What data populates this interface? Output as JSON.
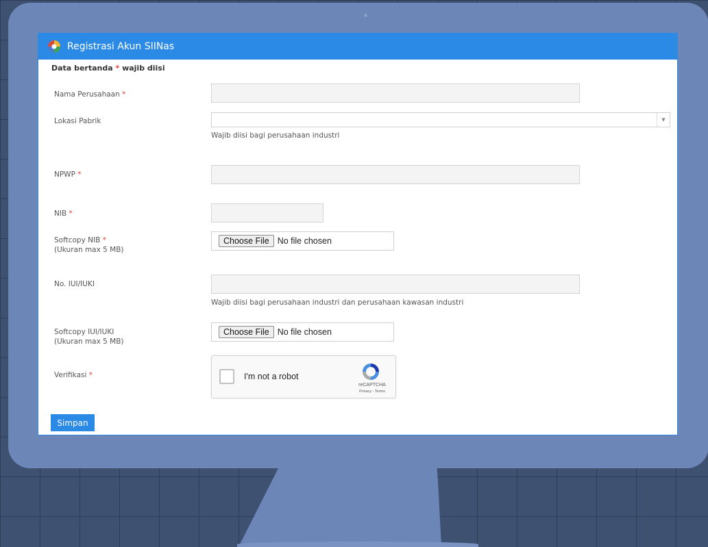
{
  "header": {
    "title": "Registrasi Akun SIINas"
  },
  "notice": {
    "text_before": "Data bertanda ",
    "star": "*",
    "text_after": " wajib diisi"
  },
  "form": {
    "nama_perusahaan": {
      "label": "Nama Perusahaan",
      "star": "*",
      "value": ""
    },
    "lokasi_pabrik": {
      "label": "Lokasi Pabrik",
      "value": "",
      "help": "Wajib diisi bagi perusahaan industri"
    },
    "npwp": {
      "label": "NPWP",
      "star": "*",
      "value": ""
    },
    "nib": {
      "label": "NIB",
      "star": "*",
      "value": ""
    },
    "softcopy_nib": {
      "label": "Softcopy NIB",
      "star": "*",
      "sublabel": "(Ukuran max 5 MB)",
      "button": "Choose File",
      "status": "No file chosen"
    },
    "no_iui": {
      "label": "No. IUI/IUKI",
      "value": "",
      "help": "Wajib diisi bagi perusahaan industri dan perusahaan kawasan industri"
    },
    "softcopy_iui": {
      "label": "Softcopy IUI/IUKI",
      "sublabel": "(Ukuran max 5 MB)",
      "button": "Choose File",
      "status": "No file chosen"
    },
    "verifikasi": {
      "label": "Verifikasi",
      "star": "*"
    }
  },
  "captcha": {
    "text": "I'm not a robot",
    "brand": "reCAPTCHA",
    "links": "Privacy - Terms"
  },
  "submit": {
    "label": "Simpan"
  },
  "colors": {
    "accent": "#2b8ae5",
    "required": "#e43c3c",
    "monitor": "#6d86b8"
  }
}
